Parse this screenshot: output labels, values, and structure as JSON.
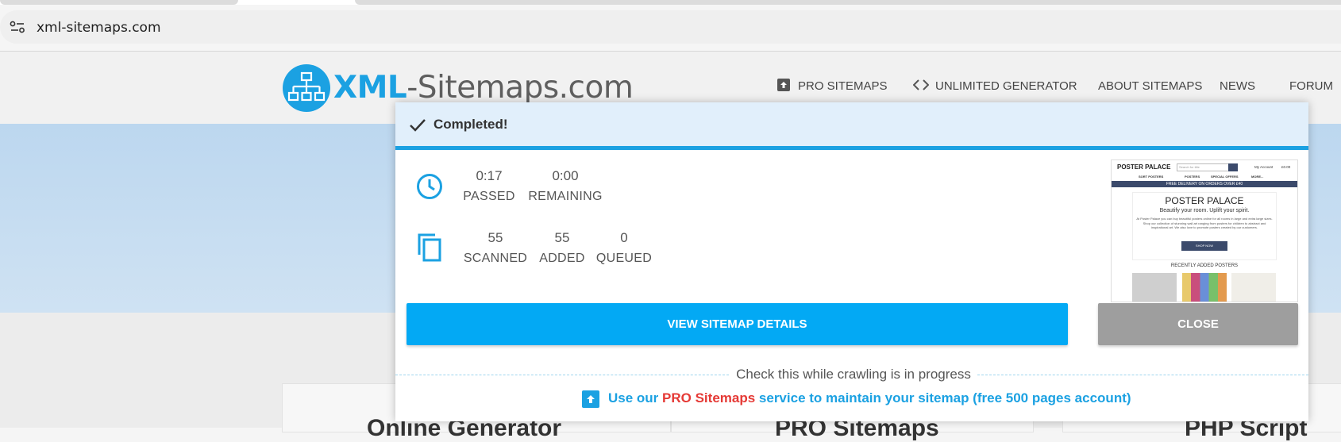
{
  "browser": {
    "url": "xml-sitemaps.com"
  },
  "site": {
    "logo_xml": "XML",
    "logo_rest": "-Sitemaps.com",
    "nav": {
      "pro": "PRO SITEMAPS",
      "unlimited": "UNLIMITED GENERATOR",
      "about": "ABOUT SITEMAPS",
      "news": "NEWS",
      "forum": "FORUM"
    },
    "cards": [
      "Online Generator",
      "PRO Sitemaps",
      "PHP Script"
    ]
  },
  "modal": {
    "status": "Completed!",
    "time": {
      "passed_value": "0:17",
      "passed_label": "PASSED",
      "remaining_value": "0:00",
      "remaining_label": "REMAINING"
    },
    "pages": {
      "scanned_value": "55",
      "scanned_label": "SCANNED",
      "added_value": "55",
      "added_label": "ADDED",
      "queued_value": "0",
      "queued_label": "QUEUED"
    },
    "thumbnail": {
      "brand": "POSTER PALACE",
      "search_placeholder": "Search for title",
      "account": "My Account",
      "cart": "£0.00",
      "menu": [
        "SORT POSTERS",
        "POSTERS",
        "SPECIAL OFFERS",
        "MORE..."
      ],
      "banner": "FREE DELIVERY ON ORDERS OVER £40",
      "heading": "POSTER PALACE",
      "tagline": "Beautify your room. Uplift your spirit.",
      "body": "At Poster Palace you can buy beautiful posters online for all rooms in large and extra large sizes. Shop our collection of stunning wall art ranging from posters for children to abstract and inspirational art. We also love to promote posters created by our customers.",
      "shop_button": "SHOP NOW",
      "recent": "RECENTLY ADDED POSTERS"
    },
    "view_button": "VIEW SITEMAP DETAILS",
    "close_button": "CLOSE",
    "check_text": "Check this while crawling is in progress",
    "promo_prefix": "Use our ",
    "promo_link": "PRO Sitemaps",
    "promo_suffix": " service to maintain your sitemap (free 500 pages account)"
  },
  "colors": {
    "brand_blue": "#1ba1e2",
    "button_blue": "#03a9f4",
    "close_grey": "#9e9e9e",
    "promo_red": "#e53935"
  }
}
